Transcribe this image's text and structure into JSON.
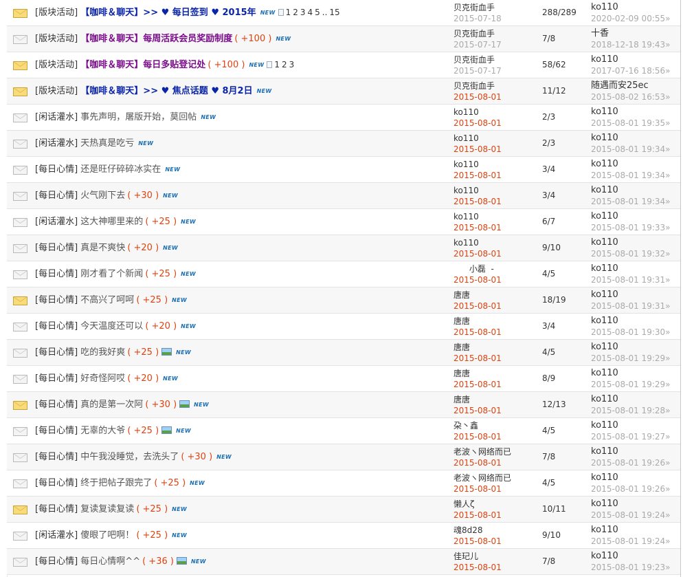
{
  "colors": {
    "accent_blue": "#0b25a8",
    "accent_purple": "#7b0e8a",
    "bonus": "#e0420f",
    "date_red": "#e0420f",
    "new_tag": "#1a6fb6"
  },
  "threads": [
    {
      "icon": "envelope-hot-icon",
      "category": "[版块活动]",
      "subject": "【咖啡＆聊天】>> ♥ 每日签到 ♥ 2015年",
      "style": "blue",
      "bonus": "",
      "has_image": false,
      "new_tag": "NEW",
      "pages": [
        "1",
        "2",
        "3",
        "4",
        "5",
        "..",
        "15"
      ],
      "author": "贝克街血手",
      "date": "2015-07-18",
      "date_red": false,
      "counts": "288/289",
      "last_author": "ko110",
      "last_time": "2020-02-09 00:55»"
    },
    {
      "icon": "envelope-icon",
      "category": "[版块活动]",
      "subject": "【咖啡＆聊天】每周活跃会员奖励制度",
      "style": "purple",
      "bonus": "( +100 )",
      "has_image": false,
      "new_tag": "NEW",
      "pages": [],
      "author": "贝克街血手",
      "date": "2015-07-17",
      "date_red": false,
      "counts": "7/8",
      "last_author": "十香",
      "last_time": "2018-12-18 19:43»"
    },
    {
      "icon": "envelope-hot-icon",
      "category": "[版块活动]",
      "subject": "【咖啡＆聊天】每日多贴登记处",
      "style": "purple",
      "bonus": "( +100 )",
      "has_image": false,
      "new_tag": "NEW",
      "pages": [
        "1",
        "2",
        "3"
      ],
      "author": "贝克街血手",
      "date": "2015-07-17",
      "date_red": false,
      "counts": "58/62",
      "last_author": "ko110",
      "last_time": "2017-07-16 18:56»"
    },
    {
      "icon": "envelope-hot-icon",
      "category": "[版块活动]",
      "subject": "【咖啡＆聊天】>> ♥ 焦点话题 ♥ 8月2日",
      "style": "blue",
      "bonus": "",
      "has_image": false,
      "new_tag": "NEW",
      "pages": [],
      "author": "贝克街血手",
      "date": "2015-08-01",
      "date_red": true,
      "counts": "11/12",
      "last_author": "随遇而安25ec",
      "last_time": "2015-08-02 16:53»"
    },
    {
      "icon": "envelope-icon",
      "category": "[闲话灌水]",
      "subject": "事先声明，屠版开始，莫回帖",
      "style": "",
      "bonus": "",
      "has_image": false,
      "new_tag": "NEW",
      "pages": [],
      "author": "ko110",
      "date": "2015-08-01",
      "date_red": true,
      "counts": "2/3",
      "last_author": "ko110",
      "last_time": "2015-08-01 19:35»"
    },
    {
      "icon": "envelope-icon",
      "category": "[闲话灌水]",
      "subject": "天热真是吃亏",
      "style": "",
      "bonus": "",
      "has_image": false,
      "new_tag": "NEW",
      "pages": [],
      "author": "ko110",
      "date": "2015-08-01",
      "date_red": true,
      "counts": "2/3",
      "last_author": "ko110",
      "last_time": "2015-08-01 19:34»"
    },
    {
      "icon": "envelope-icon",
      "category": "[每日心情]",
      "subject": "还是旺仔碎碎冰实在",
      "style": "",
      "bonus": "",
      "has_image": false,
      "new_tag": "NEW",
      "pages": [],
      "author": "ko110",
      "date": "2015-08-01",
      "date_red": true,
      "counts": "3/4",
      "last_author": "ko110",
      "last_time": "2015-08-01 19:34»"
    },
    {
      "icon": "envelope-icon",
      "category": "[每日心情]",
      "subject": "火气刚下去",
      "style": "",
      "bonus": "( +30 )",
      "has_image": false,
      "new_tag": "NEW",
      "pages": [],
      "author": "ko110",
      "date": "2015-08-01",
      "date_red": true,
      "counts": "3/4",
      "last_author": "ko110",
      "last_time": "2015-08-01 19:34»"
    },
    {
      "icon": "envelope-icon",
      "category": "[闲话灌水]",
      "subject": "这大神哪里来的",
      "style": "",
      "bonus": "( +25 )",
      "has_image": false,
      "new_tag": "NEW",
      "pages": [],
      "author": "ko110",
      "date": "2015-08-01",
      "date_red": true,
      "counts": "6/7",
      "last_author": "ko110",
      "last_time": "2015-08-01 19:33»"
    },
    {
      "icon": "envelope-icon",
      "category": "[每日心情]",
      "subject": "真是不爽快",
      "style": "",
      "bonus": "( +20 )",
      "has_image": false,
      "new_tag": "NEW",
      "pages": [],
      "author": "ko110",
      "date": "2015-08-01",
      "date_red": true,
      "counts": "9/10",
      "last_author": "ko110",
      "last_time": "2015-08-01 19:32»"
    },
    {
      "icon": "envelope-icon",
      "category": "[每日心情]",
      "subject": "刚才看了个新闻",
      "style": "",
      "bonus": "( +25 )",
      "has_image": false,
      "new_tag": "NEW",
      "pages": [],
      "author": "      小磊  -",
      "date": "2015-08-01",
      "date_red": true,
      "counts": "4/5",
      "last_author": "ko110",
      "last_time": "2015-08-01 19:31»"
    },
    {
      "icon": "envelope-hot-icon",
      "category": "[每日心情]",
      "subject": "不高兴了呵呵",
      "style": "",
      "bonus": "( +25 )",
      "has_image": false,
      "new_tag": "NEW",
      "pages": [],
      "author": "唐唐",
      "date": "2015-08-01",
      "date_red": true,
      "counts": "18/19",
      "last_author": "ko110",
      "last_time": "2015-08-01 19:31»"
    },
    {
      "icon": "envelope-icon",
      "category": "[每日心情]",
      "subject": "今天温度还可以",
      "style": "",
      "bonus": "( +20 )",
      "has_image": false,
      "new_tag": "NEW",
      "pages": [],
      "author": "唐唐",
      "date": "2015-08-01",
      "date_red": true,
      "counts": "3/4",
      "last_author": "ko110",
      "last_time": "2015-08-01 19:30»"
    },
    {
      "icon": "envelope-icon",
      "category": "[每日心情]",
      "subject": "吃的我好爽",
      "style": "",
      "bonus": "( +25 )",
      "has_image": true,
      "new_tag": "NEW",
      "pages": [],
      "author": "唐唐",
      "date": "2015-08-01",
      "date_red": true,
      "counts": "4/5",
      "last_author": "ko110",
      "last_time": "2015-08-01 19:29»"
    },
    {
      "icon": "envelope-icon",
      "category": "[每日心情]",
      "subject": "好奇怪阿哎",
      "style": "",
      "bonus": "( +20 )",
      "has_image": false,
      "new_tag": "NEW",
      "pages": [],
      "author": "唐唐",
      "date": "2015-08-01",
      "date_red": true,
      "counts": "8/9",
      "last_author": "ko110",
      "last_time": "2015-08-01 19:29»"
    },
    {
      "icon": "envelope-hot-icon",
      "category": "[每日心情]",
      "subject": "真的是第一次阿",
      "style": "",
      "bonus": "( +30 )",
      "has_image": true,
      "new_tag": "NEW",
      "pages": [],
      "author": "唐唐",
      "date": "2015-08-01",
      "date_red": true,
      "counts": "12/13",
      "last_author": "ko110",
      "last_time": "2015-08-01 19:28»"
    },
    {
      "icon": "envelope-icon",
      "category": "[每日心情]",
      "subject": "无辜的大爷",
      "style": "",
      "bonus": "( +25 )",
      "has_image": true,
      "new_tag": "NEW",
      "pages": [],
      "author": "朶丶鑫",
      "date": "2015-08-01",
      "date_red": true,
      "counts": "4/5",
      "last_author": "ko110",
      "last_time": "2015-08-01 19:27»"
    },
    {
      "icon": "envelope-icon",
      "category": "[每日心情]",
      "subject": "中午我没睡觉，去洗头了",
      "style": "",
      "bonus": "( +30 )",
      "has_image": false,
      "new_tag": "NEW",
      "pages": [],
      "author": "老波ヽ网络而已",
      "date": "2015-08-01",
      "date_red": true,
      "counts": "7/8",
      "last_author": "ko110",
      "last_time": "2015-08-01 19:26»"
    },
    {
      "icon": "envelope-icon",
      "category": "[每日心情]",
      "subject": "终于把帖子跟完了",
      "style": "",
      "bonus": "( +25 )",
      "has_image": false,
      "new_tag": "NEW",
      "pages": [],
      "author": "老波ヽ网络而已",
      "date": "2015-08-01",
      "date_red": true,
      "counts": "4/5",
      "last_author": "ko110",
      "last_time": "2015-08-01 19:26»"
    },
    {
      "icon": "envelope-hot-icon",
      "category": "[每日心情]",
      "subject": "复读复读复读",
      "style": "",
      "bonus": "( +25 )",
      "has_image": false,
      "new_tag": "NEW",
      "pages": [],
      "author": "懒人ζ",
      "date": "2015-08-01",
      "date_red": true,
      "counts": "10/11",
      "last_author": "ko110",
      "last_time": "2015-08-01 19:24»"
    },
    {
      "icon": "envelope-icon",
      "category": "[闲话灌水]",
      "subject": "傻眼了吧啊！",
      "style": "",
      "bonus": "( +25 )",
      "has_image": false,
      "new_tag": "NEW",
      "pages": [],
      "author": "魂8d28",
      "date": "2015-08-01",
      "date_red": true,
      "counts": "9/10",
      "last_author": "ko110",
      "last_time": "2015-08-01 19:24»"
    },
    {
      "icon": "envelope-icon",
      "category": "[每日心情]",
      "subject": "每日心情啊^^",
      "style": "",
      "bonus": "( +36 )",
      "has_image": true,
      "new_tag": "NEW",
      "pages": [],
      "author": "佳玘儿",
      "date": "2015-08-01",
      "date_red": true,
      "counts": "7/8",
      "last_author": "ko110",
      "last_time": "2015-08-01 19:23»"
    }
  ]
}
